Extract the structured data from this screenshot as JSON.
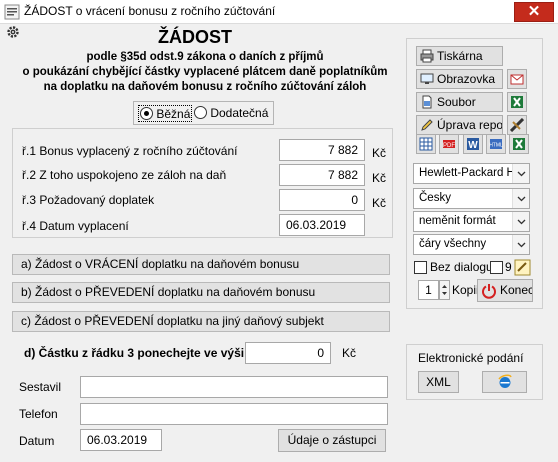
{
  "window": {
    "title": "ŽÁDOST o vrácení bonusu z ročního zúčtování",
    "close_glyph": "✕"
  },
  "heading": {
    "title": "ŽÁDOST",
    "line1": "podle §35d odst.9 zákona o daních z příjmů",
    "line2": "o poukázání chybějící částky vyplacené plátcem daně poplatníkům",
    "line3": "na doplatku na daňovém bonusu z ročního zúčtování záloh"
  },
  "type_choice": {
    "options": [
      "Běžná",
      "Dodatečná"
    ],
    "selected": "Běžná"
  },
  "rows": [
    {
      "label": "ř.1 Bonus vyplacený z ročního zúčtování",
      "value": "7 882",
      "unit": "Kč"
    },
    {
      "label": "ř.2 Z toho uspokojeno ze záloh na daň",
      "value": "7 882",
      "unit": "Kč"
    },
    {
      "label": "ř.3 Požadovaný doplatek",
      "value": "0",
      "unit": "Kč"
    },
    {
      "label": "ř.4 Datum vyplacení",
      "value": "06.03.2019",
      "unit": ""
    }
  ],
  "actions": {
    "a": "a) Žádost o VRÁCENÍ doplatku na daňovém bonusu",
    "b": "b) Žádost o PŘEVEDENÍ doplatku na daňovém bonusu",
    "c": "c) Žádost o PŘEVEDENÍ doplatku na jiný daňový subjekt"
  },
  "amount_keep": {
    "label": "d) Částku z řádku 3 ponechejte ve výši",
    "value": "0",
    "unit": "Kč"
  },
  "form": {
    "sestavil_label": "Sestavil",
    "sestavil_value": "",
    "telefon_label": "Telefon",
    "telefon_value": "",
    "datum_label": "Datum",
    "datum_value": "06.03.2019",
    "zastupci_button": "Údaje o zástupci"
  },
  "output": {
    "tiskarna": "Tiskárna",
    "obrazovka": "Obrazovka",
    "soubor": "Soubor",
    "uprava": "Úprava repor",
    "format_icons": [
      "table-icon",
      "pdf-icon",
      "word-icon",
      "html-icon",
      "excel-icon"
    ]
  },
  "settings": {
    "printer": "Hewlett-Packard HP",
    "language": "Česky",
    "format": "neměnit formát",
    "lines": "čáry všechny",
    "bez_dialogu": "Bez dialogu",
    "bez_dialogu_checked": false,
    "nine_label": "9",
    "nine_checked": false,
    "copies": "1",
    "copies_label": "Kopii",
    "konec": "Konec"
  },
  "epodani": {
    "title": "Elektronické podání",
    "xml_button": "XML"
  },
  "colors": {
    "close_red": "#c42b1c",
    "konec_red": "#d42020",
    "excel_green": "#1e7a3a",
    "ie_blue": "#1a78d0"
  }
}
